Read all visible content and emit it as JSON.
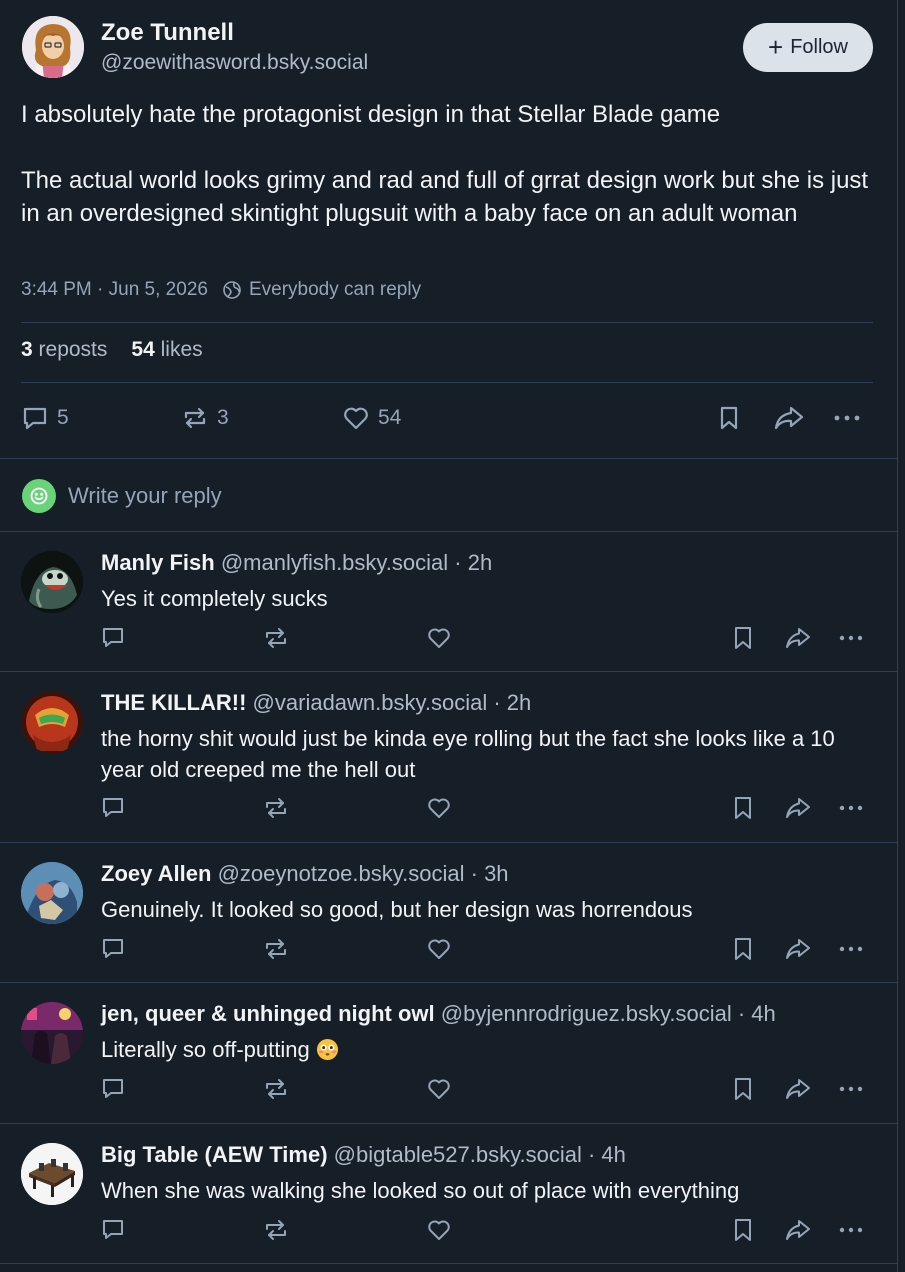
{
  "post": {
    "author_name": "Zoe Tunnell",
    "author_handle": "@zoewithasword.bsky.social",
    "follow_label": "Follow",
    "text_p1": "I absolutely hate the protagonist design in that Stellar Blade game",
    "text_p2": "The actual world looks grimy and rad and full of grrat design work but she is just in an overdesigned skintight plugsuit with a baby face on an adult woman",
    "timestamp": "3:44 PM · Jun 5, 2026",
    "reply_setting": "Everybody can reply",
    "reposts_count": "3",
    "reposts_label": "reposts",
    "likes_count": "54",
    "likes_label": "likes",
    "actions": {
      "replies": "5",
      "reposts": "3",
      "likes": "54"
    }
  },
  "composer": {
    "placeholder": "Write your reply"
  },
  "replies": [
    {
      "name": "Manly Fish",
      "handle": "@manlyfish.bsky.social",
      "time": "2h",
      "text": "Yes it completely sucks"
    },
    {
      "name": "THE KILLAR!!",
      "handle": "@variadawn.bsky.social",
      "time": "2h",
      "text": "the horny shit would just be kinda eye rolling but the fact she looks like a 10 year old creeped me the hell out"
    },
    {
      "name": "Zoey Allen",
      "handle": "@zoeynotzoe.bsky.social",
      "time": "3h",
      "text": "Genuinely. It looked so good, but her design was horrendous"
    },
    {
      "name": "jen, queer & unhinged night owl",
      "handle": "@byjennrodriguez.bsky.social",
      "time": "4h",
      "text": "Literally so off-putting"
    },
    {
      "name": "Big Table (AEW Time)",
      "handle": "@bigtable527.bsky.social",
      "time": "4h",
      "text": "When she was walking she looked so out of place with everything"
    }
  ],
  "separator": " · ",
  "colors": {
    "background": "#161e27",
    "border": "#2e4052",
    "muted": "#93a5b7",
    "accent_green": "#6ad37a"
  }
}
